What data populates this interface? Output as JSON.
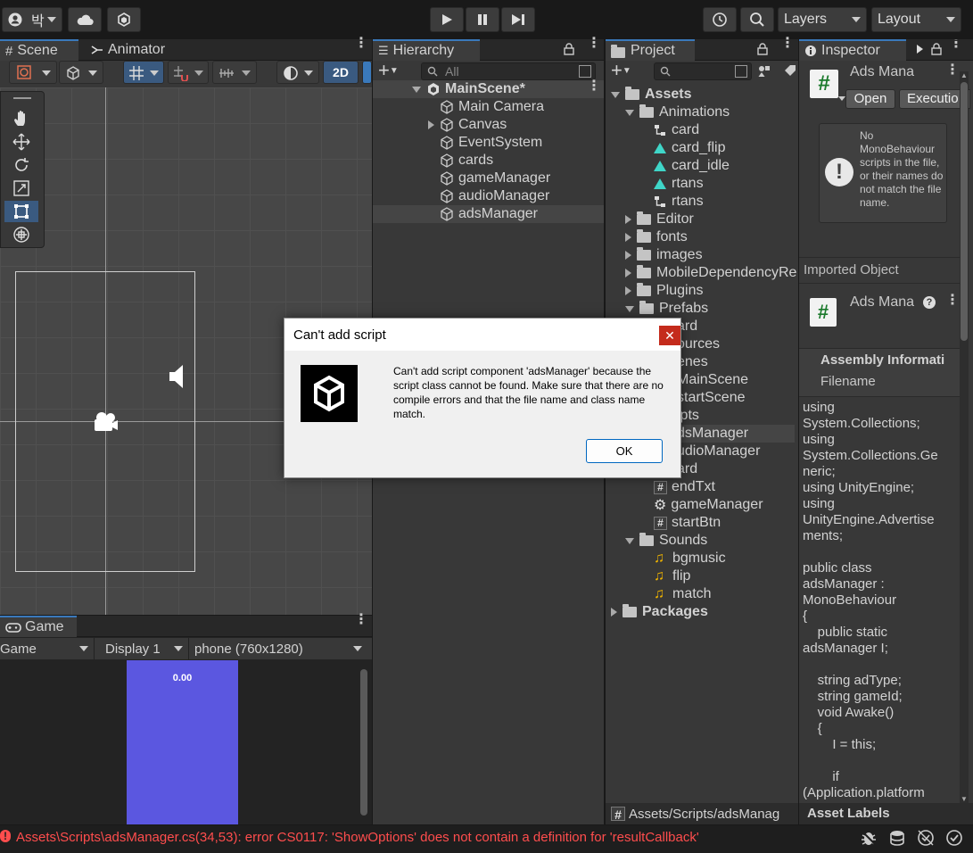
{
  "toolbar": {
    "account_label": "박",
    "layers_label": "Layers",
    "layout_label": "Layout"
  },
  "scene_panel": {
    "tab_scene": "Scene",
    "tab_animator": "Animator",
    "mode_2d": "2D"
  },
  "game_panel": {
    "tab_game": "Game",
    "view_select": "Game",
    "display_select": "Display 1",
    "resolution_select": "phone (760x1280)",
    "overlay_text": "0.00",
    "viewport_color": "#5b57e0"
  },
  "hierarchy": {
    "tab_label": "Hierarchy",
    "search_placeholder": "All",
    "scene_name": "MainScene*",
    "items": [
      "Main Camera",
      "Canvas",
      "EventSystem",
      "cards",
      "gameManager",
      "audioManager",
      "adsManager"
    ]
  },
  "project": {
    "tab_label": "Project",
    "assets_label": "Assets",
    "rows": [
      {
        "label": "Animations"
      },
      {
        "label": "card"
      },
      {
        "label": "card_flip"
      },
      {
        "label": "card_idle"
      },
      {
        "label": "rtans"
      },
      {
        "label": "rtans"
      },
      {
        "label": "Editor"
      },
      {
        "label": "fonts"
      },
      {
        "label": "images"
      },
      {
        "label": "MobileDependencyRe"
      },
      {
        "label": "Plugins"
      },
      {
        "label": "Prefabs"
      },
      {
        "label": "ard"
      },
      {
        "label": "ources"
      },
      {
        "label": "enes"
      },
      {
        "label": "MainScene"
      },
      {
        "label": "startScene"
      },
      {
        "label": "ipts"
      },
      {
        "label": "dsManager"
      },
      {
        "label": "udioManager"
      },
      {
        "label": "ard"
      },
      {
        "label": "endTxt"
      },
      {
        "label": "gameManager"
      },
      {
        "label": "startBtn"
      },
      {
        "label": "Sounds"
      },
      {
        "label": "bgmusic"
      },
      {
        "label": "flip"
      },
      {
        "label": "match"
      },
      {
        "label": "Packages"
      }
    ],
    "footer_path": "Assets/Scripts/adsManag"
  },
  "inspector": {
    "tab_label": "Inspector",
    "asset_title": "Ads Mana",
    "open_button": "Open",
    "execution_button": "Executio",
    "warning_text": "No MonoBehaviour scripts in the file, or their names do not match the file name.",
    "imported_object_label": "Imported Object",
    "imported_title": "Ads Mana",
    "assembly_info": "Assembly Informati",
    "filename_label": "Filename",
    "code_lines": [
      "using",
      "System.Collections;",
      "using",
      "System.Collections.Ge",
      "neric;",
      "using UnityEngine;",
      "using",
      "UnityEngine.Advertise",
      "ments;",
      "",
      "public class",
      "adsManager :",
      "MonoBehaviour",
      "{",
      "    public static",
      "adsManager I;",
      "",
      "    string adType;",
      "    string gameId;",
      "    void Awake()",
      "    {",
      "        I = this;",
      "",
      "        if",
      "(Application.platform"
    ],
    "asset_labels": "Asset Labels"
  },
  "status": {
    "error_text": "Assets\\Scripts\\adsManager.cs(34,53): error CS0117: 'ShowOptions' does not contain a definition for 'resultCallback'",
    "error_color": "#ff4d4d"
  },
  "dialog": {
    "title": "Can't add script",
    "message": "Can't add script component 'adsManager' because the script class cannot be found. Make sure that there are no compile errors and that the file name and class name match.",
    "ok_label": "OK"
  }
}
